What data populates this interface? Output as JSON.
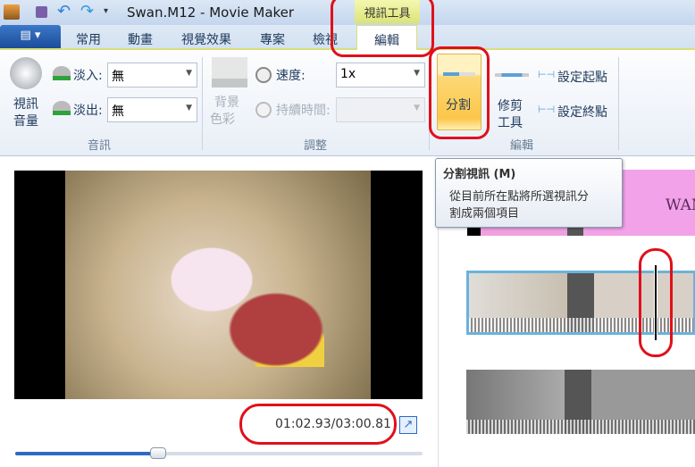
{
  "title": "Swan.M12 - Movie Maker",
  "contextual_tab": "視訊工具",
  "tabs": [
    "常用",
    "動畫",
    "視覺效果",
    "專案",
    "檢視",
    "編輯"
  ],
  "audio": {
    "volume_label_1": "視訊",
    "volume_label_2": "音量",
    "fade_in_label": "淡入:",
    "fade_in_value": "無",
    "fade_out_label": "淡出:",
    "fade_out_value": "無",
    "group": "音訊"
  },
  "adjust": {
    "bg_label_1": "背景",
    "bg_label_2": "色彩",
    "speed_label": "速度:",
    "speed_value": "1x",
    "duration_label": "持續時間:",
    "duration_value": "",
    "group": "調整"
  },
  "edit": {
    "split": "分割",
    "trim_1": "修剪",
    "trim_2": "工具",
    "set_start": "設定起點",
    "set_end": "設定終點",
    "group": "編輯"
  },
  "tooltip": {
    "title": "分割視訊 (M)",
    "body_1": "從目前所在點將所選視訊分",
    "body_2": "割成兩個項目"
  },
  "preview": {
    "time": "01:02.93/03:00.81",
    "progress": 0.35
  },
  "colors": {
    "accent": "#2a6bc4",
    "annotation": "#e0101a",
    "split_active": "#fcd875"
  }
}
